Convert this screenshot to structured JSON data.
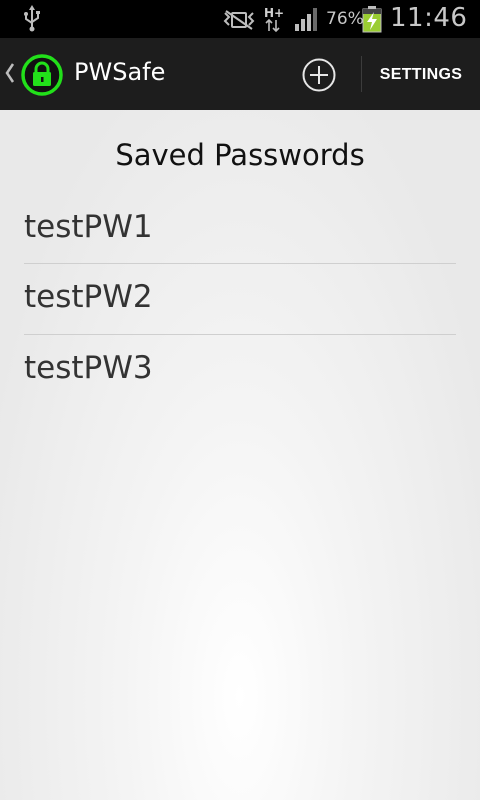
{
  "status_bar": {
    "icons": [
      "usb-icon",
      "mute-icon",
      "network-hplus-icon",
      "signal-icon",
      "battery-charging-icon"
    ],
    "network_type": "H+",
    "battery_percent": "76%",
    "time": "11:46"
  },
  "action_bar": {
    "title": "PWSafe",
    "app_icon": "lock-icon",
    "app_icon_color": "#00e000",
    "add_icon": "add-circle-icon",
    "settings_label": "SETTINGS"
  },
  "main": {
    "heading": "Saved Passwords",
    "items": [
      {
        "label": "testPW1"
      },
      {
        "label": "testPW2"
      },
      {
        "label": "testPW3"
      }
    ]
  }
}
